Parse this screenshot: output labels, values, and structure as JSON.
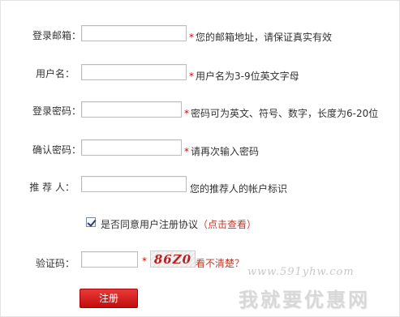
{
  "form": {
    "email": {
      "label": "登录邮箱：",
      "value": "",
      "star": "*",
      "hint": "您的邮箱地址，请保证真实有效"
    },
    "username": {
      "label": "用户名：",
      "value": "",
      "star": "*",
      "hint": "用户名为3-9位英文字母"
    },
    "password": {
      "label": "登录密码：",
      "value": "",
      "star": "*",
      "hint": "密码可为英文、符号、数字，长度为6-20位"
    },
    "confirm_password": {
      "label": "确认密码：",
      "value": "",
      "star": "*",
      "hint": "请再次输入密码"
    },
    "referrer": {
      "label": "推 荐 人：",
      "value": "",
      "hint": "您的推荐人的帐户标识"
    },
    "agree": {
      "checked": true,
      "label": "是否同意用户注册协议",
      "link": "（点击查看）"
    },
    "captcha": {
      "label": "验证码：",
      "value": "",
      "star": "*",
      "image_text": "86Z0",
      "refresh": "看不清楚？"
    },
    "submit_label": "注册"
  },
  "watermark": {
    "url": "www.591yhw.com",
    "text": "我就要优惠网"
  },
  "colors": {
    "required_star": "#d40000",
    "link": "#c0392b",
    "submit_bg": "#d41a1a"
  }
}
